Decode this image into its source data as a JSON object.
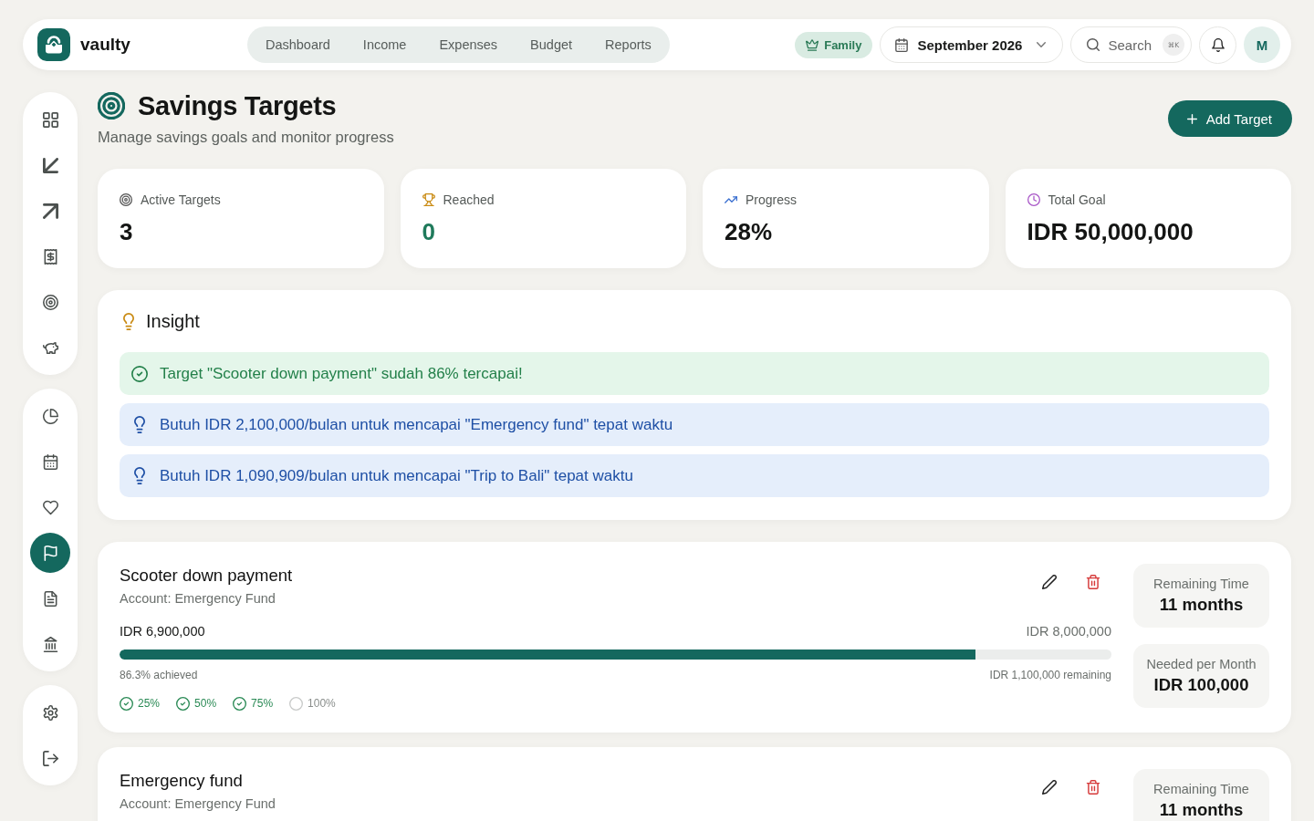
{
  "topbar": {
    "brand": "vaulty",
    "tabs": [
      {
        "label": "Dashboard",
        "selected": false
      },
      {
        "label": "Income",
        "selected": false
      },
      {
        "label": "Expenses",
        "selected": false
      },
      {
        "label": "Budget",
        "selected": false
      },
      {
        "label": "Reports",
        "selected": false
      }
    ],
    "plan": "Family",
    "month": "September 2026",
    "search": {
      "label": "Search",
      "shortcut": "⌘K"
    },
    "avatar": "M"
  },
  "sidebar": {
    "groups": [
      {
        "items": [
          {
            "kind": "grid",
            "selected": false
          },
          {
            "kind": "inbound",
            "selected": false
          },
          {
            "kind": "outbound",
            "selected": false
          },
          {
            "kind": "receipt",
            "selected": false
          },
          {
            "kind": "target",
            "selected": false
          },
          {
            "kind": "piggy",
            "selected": false
          }
        ]
      },
      {
        "items": [
          {
            "kind": "pie",
            "selected": false
          },
          {
            "kind": "calendar",
            "selected": false
          },
          {
            "kind": "heart",
            "selected": false
          },
          {
            "kind": "flag",
            "selected": true
          },
          {
            "kind": "document",
            "selected": false
          },
          {
            "kind": "bank",
            "selected": false
          }
        ]
      },
      {
        "items": [
          {
            "kind": "gear",
            "selected": false
          },
          {
            "kind": "logout",
            "selected": false
          }
        ]
      }
    ]
  },
  "page": {
    "title": "Savings Targets",
    "subtitle": "Manage savings goals and monitor progress",
    "action": "Add Target"
  },
  "stats": [
    {
      "kind": "targets",
      "label": "Active Targets",
      "value": "3"
    },
    {
      "kind": "reached",
      "label": "Reached",
      "value": "0"
    },
    {
      "kind": "progress",
      "label": "Progress",
      "value": "28%"
    },
    {
      "kind": "total",
      "label": "Total Goal",
      "value": "IDR 50,000,000"
    }
  ],
  "insight": {
    "title": "Insight",
    "items": [
      {
        "kind": "success",
        "text": "Target \"Scooter down payment\" sudah 86% tercapai!"
      },
      {
        "kind": "info",
        "text": "Butuh IDR 2,100,000/bulan untuk mencapai \"Emergency fund\" tepat waktu"
      },
      {
        "kind": "info",
        "text": "Butuh IDR 1,090,909/bulan untuk mencapai \"Trip to Bali\" tepat waktu"
      }
    ]
  },
  "targets": [
    {
      "name": "Scooter down payment",
      "account": "Account: Emergency Fund",
      "saved": "IDR 6,900,000",
      "goal": "IDR 8,000,000",
      "level": 0.863,
      "achieved": "86.3% achieved",
      "remaining": "IDR 1,100,000 remaining",
      "milestones": [
        {
          "label": "25%",
          "reached": true
        },
        {
          "label": "50%",
          "reached": true
        },
        {
          "label": "75%",
          "reached": true
        },
        {
          "label": "100%",
          "reached": false
        }
      ],
      "stats": [
        {
          "label": "Remaining Time",
          "value": "11 months"
        },
        {
          "label": "Needed per Month",
          "value": "IDR 100,000"
        }
      ]
    },
    {
      "name": "Emergency fund",
      "account": "Account: Emergency Fund",
      "stats": [
        {
          "label": "Remaining Time",
          "value": "11 months"
        }
      ]
    }
  ]
}
